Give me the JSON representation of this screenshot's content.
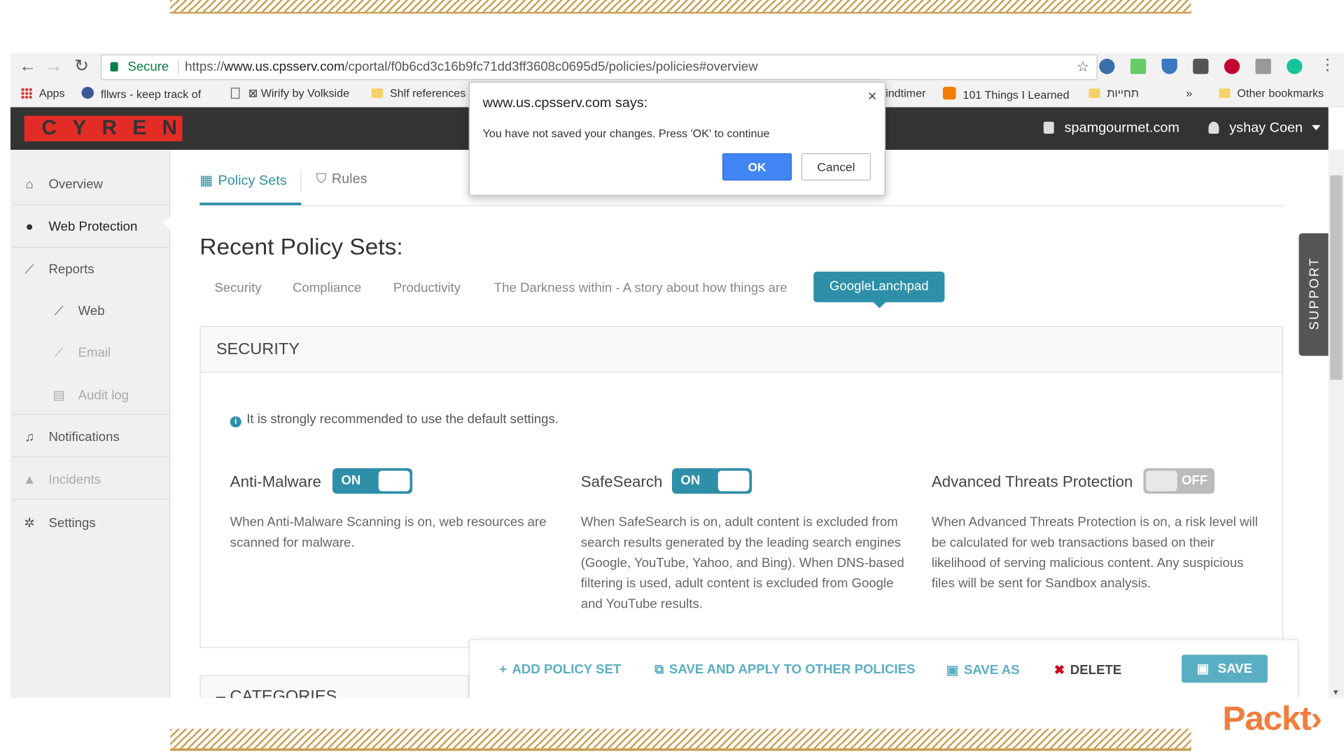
{
  "browser": {
    "secure_label": "Secure",
    "url_scheme": "https://",
    "url_host": "www.us.cpsserv.com",
    "url_path": "/cportal/f0b6cd3c16b9fc71dd3ff3608c0695d5/policies/policies#overview",
    "bookmarks": {
      "apps": "Apps",
      "fllwrs": "fllwrs - keep track of",
      "wirify": "⊠ Wirify by Volkside",
      "shlf": "Shlf references",
      "mindtimer": "indtimer",
      "things": "101 Things I Learned",
      "hebrew": "תחייות",
      "more": "»",
      "other": "Other bookmarks"
    }
  },
  "header": {
    "logo_text": "CYREN",
    "domain": "spamgourmet.com",
    "user": "yshay Coen"
  },
  "sidebar": {
    "overview": "Overview",
    "web_protection": "Web Protection",
    "reports": "Reports",
    "web": "Web",
    "email": "Email",
    "audit_log": "Audit log",
    "notifications": "Notifications",
    "incidents": "Incidents",
    "settings": "Settings"
  },
  "tabs": {
    "policy_sets": "Policy Sets",
    "rules": "Rules"
  },
  "main": {
    "title": "Recent Policy Sets:",
    "policy_sets": [
      "Security",
      "Compliance",
      "Productivity",
      "The Darkness within - A story about how things are"
    ],
    "active_policy_set": "GoogleLanchpad",
    "panel_title": "SECURITY",
    "notice": "It is strongly recommended to use the default settings.",
    "features": [
      {
        "name": "Anti-Malware",
        "state": "ON",
        "description": "When Anti-Malware Scanning is on, web resources are scanned for malware."
      },
      {
        "name": "SafeSearch",
        "state": "ON",
        "description": "When SafeSearch is on, adult content is excluded from search results generated by the leading search engines (Google, YouTube, Yahoo, and Bing). When DNS-based filtering is used, adult content is excluded from Google and YouTube results."
      },
      {
        "name": "Advanced Threats Protection",
        "state": "OFF",
        "description": "When Advanced Threats Protection is on, a risk level will be calculated for web transactions based on their likelihood of serving malicious content. Any suspicious files will be sent for Sandbox analysis."
      }
    ],
    "categories_label": "– CATEGORIES"
  },
  "actions": {
    "add_policy_set": "ADD POLICY SET",
    "save_apply": "SAVE AND APPLY TO OTHER POLICIES",
    "save_as": "SAVE AS",
    "delete": "DELETE",
    "save": "SAVE"
  },
  "support_label": "SUPPORT",
  "dialog": {
    "title": "www.us.cpsserv.com says:",
    "message": "You have not saved your changes. Press 'OK' to continue",
    "ok": "OK",
    "cancel": "Cancel",
    "close": "×"
  },
  "watermark": "Packt›",
  "colors": {
    "accent": "#2e8fa8",
    "action_text": "#5aaec4",
    "brand_red": "#e32c25",
    "header_bg": "#333333",
    "delete_icon": "#d0021b",
    "dialog_ok": "#4285f4",
    "decor_hatch": "#c8a055",
    "watermark": "#f07e3c"
  }
}
